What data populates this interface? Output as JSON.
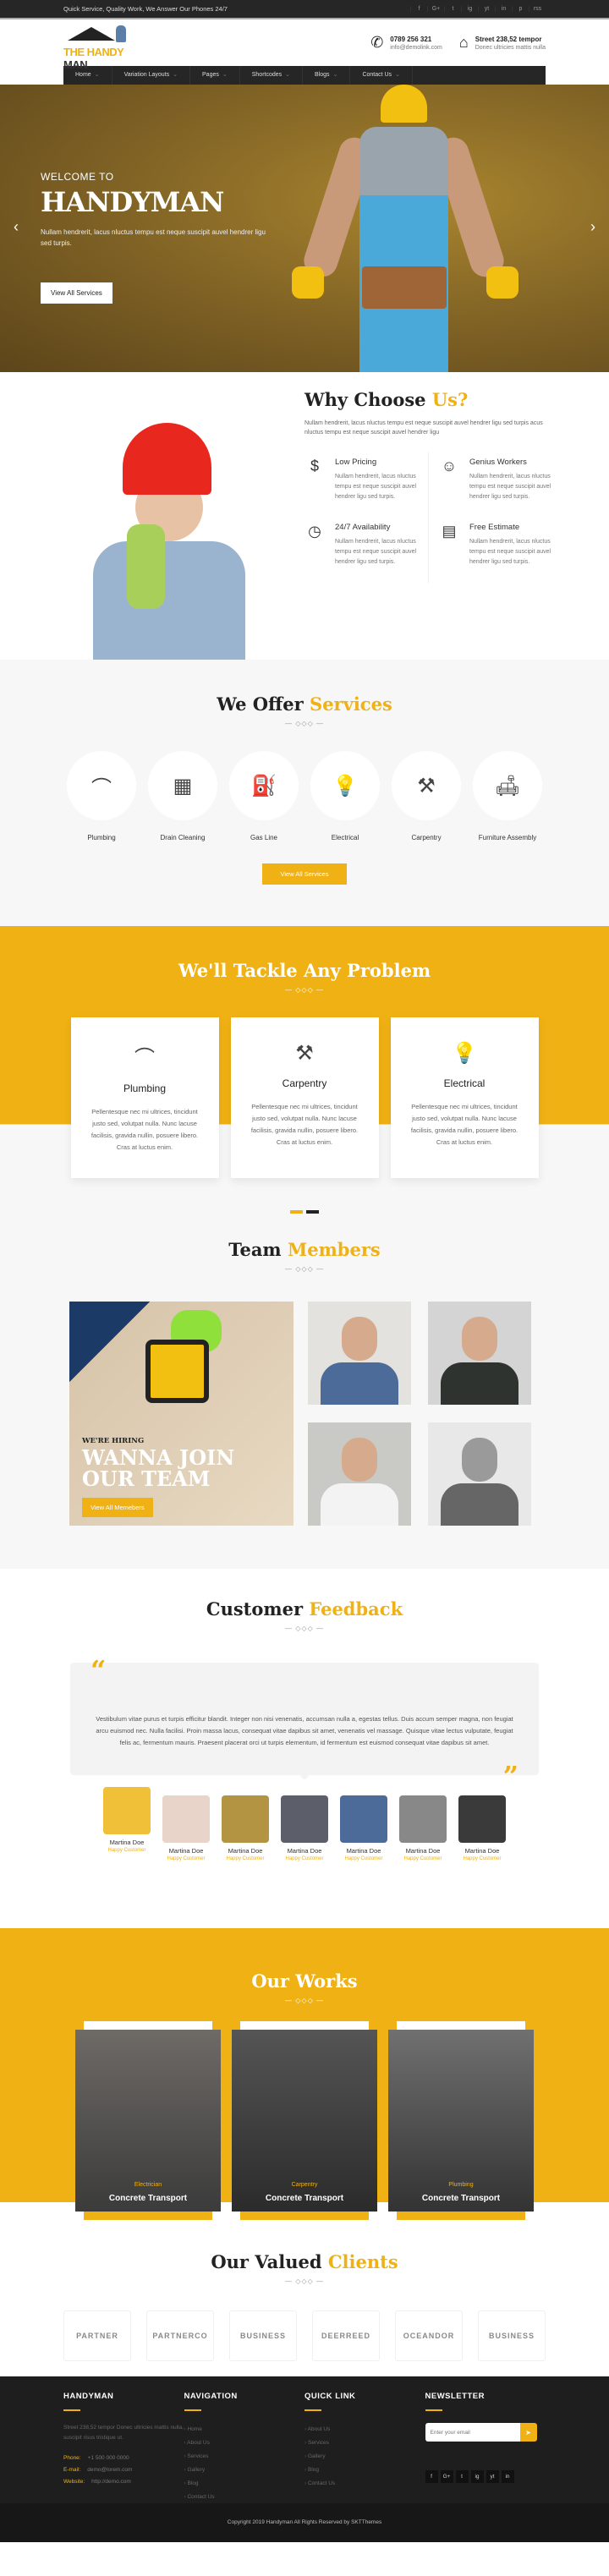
{
  "topbar": {
    "tagline": "Quick Service, Quality Work, We Answer Our Phones 24/7",
    "social": [
      "f",
      "G+",
      "t",
      "ig",
      "yt",
      "in",
      "p",
      "rss"
    ]
  },
  "header": {
    "logo_part1": "THE HANDY",
    "logo_part2": " MAN",
    "phone": "0789 256 321",
    "email": "info@demolink.com",
    "address_line1": "Street 238,52 tempor",
    "address_line2": "Donec ultricies mattis nulla"
  },
  "nav": [
    {
      "label": "Home"
    },
    {
      "label": "Variation Layouts"
    },
    {
      "label": "Pages"
    },
    {
      "label": "Shortcodes"
    },
    {
      "label": "Blogs"
    },
    {
      "label": "Contact Us"
    }
  ],
  "hero": {
    "welcome": "WELCOME TO",
    "title": "HANDYMAN",
    "text": "Nullam hendrerit, lacus nluctus tempu est neque suscipit auvel hendrer ligu sed turpis.",
    "button": "View All Services"
  },
  "why": {
    "title_main": "Why Choose ",
    "title_accent": "Us?",
    "lead": "Nullam hendrerit, lacus nluctus tempu est neque suscipit auvel hendrer ligu sed turpis acus nluctus tempu est neque suscipit auvel hendrer ligu",
    "features": [
      {
        "icon": "$",
        "title": "Low Pricing",
        "text": "Nullam hendrerit, lacus nluctus tempu est neque suscipit auvel hendrer ligu sed turpis."
      },
      {
        "icon": "☺",
        "title": "Genius Workers",
        "text": "Nullam hendrerit, lacus nluctus tempu est neque suscipit auvel hendrer ligu sed turpis."
      },
      {
        "icon": "◷",
        "title": "24/7 Availability",
        "text": "Nullam hendrerit, lacus nluctus tempu est neque suscipit auvel hendrer ligu sed turpis."
      },
      {
        "icon": "▤",
        "title": "Free Estimate",
        "text": "Nullam hendrerit, lacus nluctus tempu est neque suscipit auvel hendrer ligu sed turpis."
      }
    ]
  },
  "services": {
    "title_main": "We Offer ",
    "title_accent": "Services",
    "divider": "— ◇◇◇ —",
    "items": [
      {
        "icon": "⌒",
        "label": "Plumbing"
      },
      {
        "icon": "▦",
        "label": "Drain Cleaning"
      },
      {
        "icon": "⛽",
        "label": "Gas Line"
      },
      {
        "icon": "💡",
        "label": "Electrical"
      },
      {
        "icon": "⚒",
        "label": "Carpentry"
      },
      {
        "icon": "🛋",
        "label": "Furniture Assembly"
      }
    ],
    "button": "View All Services"
  },
  "tackle": {
    "title": "We'll Tackle Any Problem",
    "divider": "— ◇◇◇ —",
    "cards": [
      {
        "icon": "⌒",
        "title": "Plumbing",
        "text": "Pellentesque nec mi ultrices, tincidunt justo sed, volutpat nulla. Nunc lacuse facilisis, gravida nullin, posuere libero. Cras at luctus enim."
      },
      {
        "icon": "⚒",
        "title": "Carpentry",
        "text": "Pellentesque nec mi ultrices, tincidunt justo sed, volutpat nulla. Nunc lacuse facilisis, gravida nullin, posuere libero. Cras at luctus enim."
      },
      {
        "icon": "💡",
        "title": "Electrical",
        "text": "Pellentesque nec mi ultrices, tincidunt justo sed, volutpat nulla. Nunc lacuse facilisis, gravida nullin, posuere libero. Cras at luctus enim."
      }
    ]
  },
  "team": {
    "title_main": "Team ",
    "title_accent": "Members",
    "divider": "— ◇◇◇ —",
    "hiring_small": "WE'RE HIRING",
    "hiring_big": "WANNA JOIN OUR TEAM",
    "button": "View All Memebers"
  },
  "feedback": {
    "title_main": "Customer ",
    "title_accent": "Feedback",
    "divider": "— ◇◇◇ —",
    "quote": "Vestibulum vitae purus et turpis efficitur blandit. Integer non nisi venenatis, accumsan nulla a, egestas tellus. Duis accum semper magna, non feugiat arcu euismod nec. Nulla facilisi. Proin massa lacus, consequat vitae dapibus sit amet, venenatis vel massage. Quisque vitae lectus vulputate, feugiat felis ac, fermentum mauris. Praesent placerat orci ut turpis elementum, id fermentum est euismod consequat vitae dapibus sit amet.",
    "customers": [
      {
        "name": "Martina Doe",
        "role": "Happy Customer"
      },
      {
        "name": "Martina Doe",
        "role": "Happy Customer"
      },
      {
        "name": "Martina Doe",
        "role": "Happy Customer"
      },
      {
        "name": "Martina Doe",
        "role": "Happy Customer"
      },
      {
        "name": "Martina Doe",
        "role": "Happy Customer"
      },
      {
        "name": "Martina Doe",
        "role": "Happy Customer"
      },
      {
        "name": "Martina Doe",
        "role": "Happy Customer"
      }
    ]
  },
  "works": {
    "title": "Our Works",
    "divider": "— ◇◇◇ —",
    "items": [
      {
        "category": "Electrician",
        "name": "Concrete Transport"
      },
      {
        "category": "Carpentry",
        "name": "Concrete Transport"
      },
      {
        "category": "Plumbing",
        "name": "Concrete Transport"
      }
    ]
  },
  "clients": {
    "title_main": "Our Valued ",
    "title_accent": "Clients",
    "divider": "— ◇◇◇ —",
    "logos": [
      "PARTNER",
      "PARTNERCO",
      "BUSINESS",
      "DEERREED",
      "OCEANDOR",
      "BUSINESS"
    ]
  },
  "footer": {
    "about_title": "HANDYMAN",
    "about_text": "Street 238,52 tempor Donec ultricies mattis nulla, suscipit risus tristique ut.",
    "phone_label": "Phone:",
    "phone": "+1 500 000 0000",
    "email_label": "E-mail:",
    "email": "demo@lorem.com",
    "web_label": "Website:",
    "web": "http://demo.com",
    "nav_title": "NAVIGATION",
    "nav_links": [
      "Home",
      "About Us",
      "Services",
      "Gallery",
      "Blog",
      "Contact Us"
    ],
    "quick_title": "QUICK LINK",
    "quick_links": [
      "About Us",
      "Services",
      "Gallery",
      "Blog",
      "Contact Us"
    ],
    "newsletter_title": "NEWSLETTER",
    "newsletter_placeholder": "Enter your email",
    "social": [
      "f",
      "G+",
      "t",
      "ig",
      "yt",
      "in"
    ],
    "copyright": "Copyright 2019 Handyman All Rights Reserved by SKTThemes"
  }
}
